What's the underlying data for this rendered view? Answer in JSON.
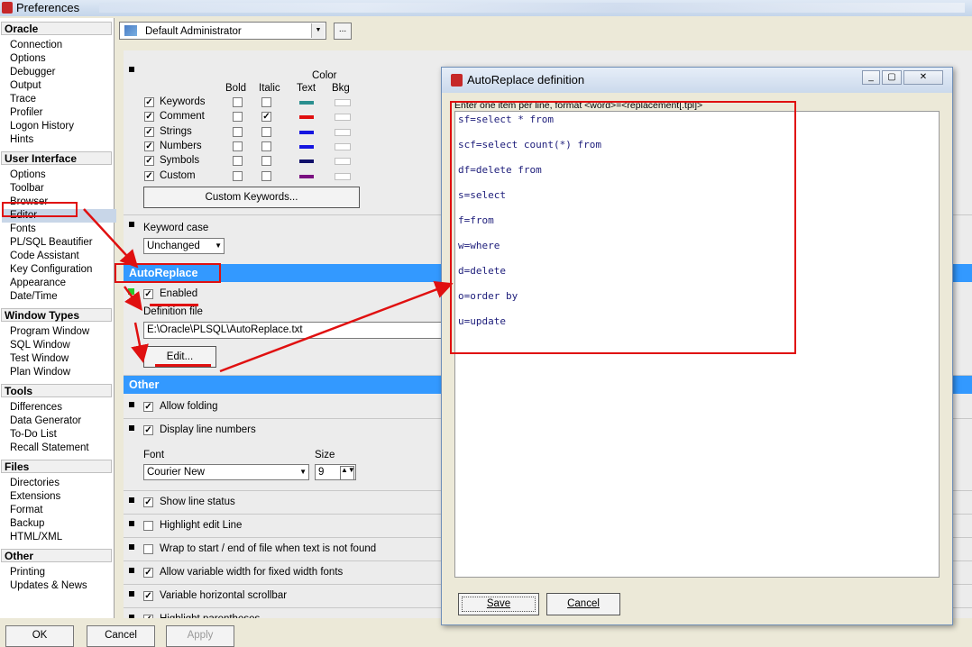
{
  "window": {
    "title": "Preferences"
  },
  "sidebar": {
    "groups": [
      {
        "label": "Oracle",
        "items": [
          "Connection",
          "Options",
          "Debugger",
          "Output",
          "Trace",
          "Profiler",
          "Logon History",
          "Hints"
        ]
      },
      {
        "label": "User Interface",
        "items": [
          "Options",
          "Toolbar",
          "Browser",
          "Editor",
          "Fonts",
          "PL/SQL Beautifier",
          "Code Assistant",
          "Key Configuration",
          "Appearance",
          "Date/Time"
        ]
      },
      {
        "label": "Window Types",
        "items": [
          "Program Window",
          "SQL Window",
          "Test Window",
          "Plan Window"
        ]
      },
      {
        "label": "Tools",
        "items": [
          "Differences",
          "Data Generator",
          "To-Do List",
          "Recall Statement"
        ]
      },
      {
        "label": "Files",
        "items": [
          "Directories",
          "Extensions",
          "Format",
          "Backup",
          "HTML/XML"
        ]
      },
      {
        "label": "Other",
        "items": [
          "Printing",
          "Updates & News"
        ]
      }
    ],
    "selected": "Editor"
  },
  "profile": {
    "value": "Default Administrator",
    "more_label": "..."
  },
  "syntax": {
    "color_header": "Color",
    "columns": [
      "Bold",
      "Italic",
      "Text",
      "Bkg"
    ],
    "rows": [
      {
        "label": "Keywords",
        "bold": false,
        "italic": false,
        "color": "#2a8f8f"
      },
      {
        "label": "Comment",
        "bold": false,
        "italic": true,
        "color": "#e01010"
      },
      {
        "label": "Strings",
        "bold": false,
        "italic": false,
        "color": "#1515e0"
      },
      {
        "label": "Numbers",
        "bold": false,
        "italic": false,
        "color": "#1515e0"
      },
      {
        "label": "Symbols",
        "bold": false,
        "italic": false,
        "color": "#10106a"
      },
      {
        "label": "Custom",
        "bold": false,
        "italic": false,
        "color": "#7a1080"
      }
    ],
    "custom_keywords_button": "Custom Keywords..."
  },
  "keyword_case": {
    "label": "Keyword case",
    "value": "Unchanged"
  },
  "autoreplace": {
    "header": "AutoReplace",
    "enabled_label": "Enabled",
    "definition_file_label": "Definition file",
    "definition_file": "E:\\Oracle\\PLSQL\\AutoReplace.txt",
    "edit_button": "Edit..."
  },
  "other": {
    "header": "Other",
    "allow_folding": "Allow folding",
    "display_line_numbers": "Display line numbers",
    "font_label": "Font",
    "font_value": "Courier New",
    "size_label": "Size",
    "size_value": "9",
    "show_line_status": "Show line status",
    "highlight_edit_line": "Highlight edit Line",
    "wrap": "Wrap to start / end of file when text is not found",
    "variable_width": "Allow variable width for fixed width fonts",
    "variable_scrollbar": "Variable horizontal scrollbar",
    "highlight_parentheses": "Highlight parentheses"
  },
  "footer": {
    "ok": "OK",
    "cancel": "Cancel",
    "apply": "Apply"
  },
  "dialog": {
    "title": "AutoReplace definition",
    "hint": "Enter one item per line, format <word>=<replacement[.tpl]>",
    "lines": [
      "sf=select * from",
      "scf=select count(*) from",
      "df=delete from",
      "s=select",
      "f=from",
      "w=where",
      "d=delete",
      "o=order by",
      "u=update"
    ],
    "save": "Save",
    "cancel": "Cancel"
  },
  "colors": {
    "section_header": "#3399ff",
    "annotation": "#e01010"
  }
}
